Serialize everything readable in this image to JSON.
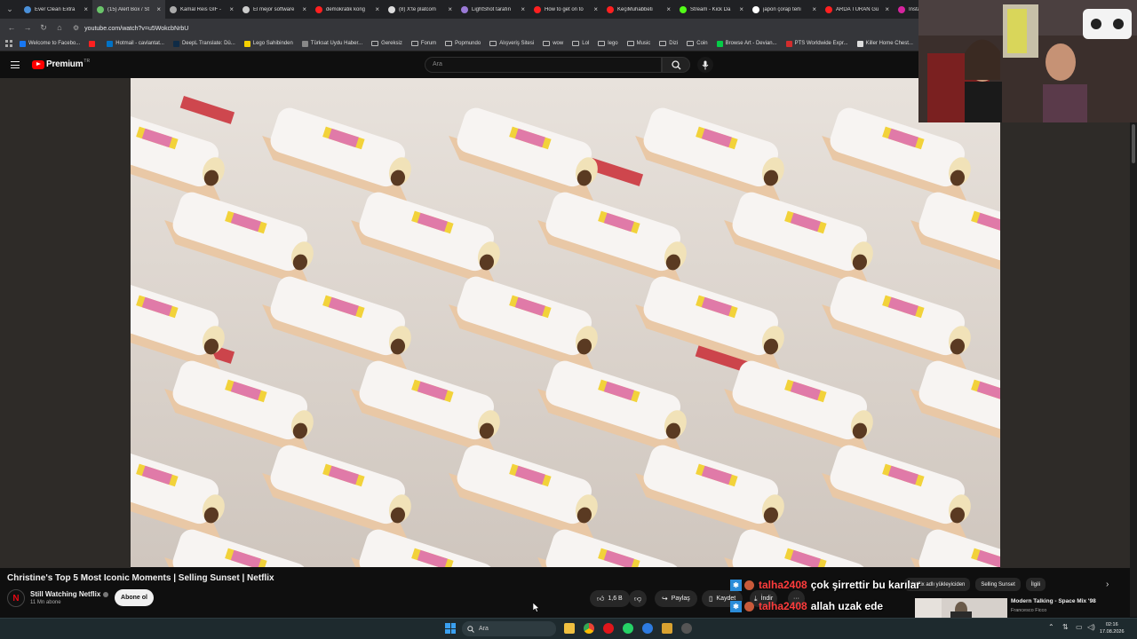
{
  "browser": {
    "tabs": [
      {
        "title": "Ever Clean Extra",
        "color": "#4a90d9"
      },
      {
        "title": "(15) Alert Box / St",
        "color": "#6ac46a"
      },
      {
        "title": "Kamal Reis GIF - ",
        "color": "#aaaaaa"
      },
      {
        "title": "El mejor software",
        "color": "#cccccc"
      },
      {
        "title": "demokratik kong",
        "color": "#ff2020"
      },
      {
        "title": "(8) X'te platcom",
        "color": "#dddddd"
      },
      {
        "title": "LightShot tarafın",
        "color": "#9a7ad6"
      },
      {
        "title": "How to get on to",
        "color": "#ff2020"
      },
      {
        "title": "KeçiMuhabbeti",
        "color": "#ff2020"
      },
      {
        "title": "Stream - Kick Da",
        "color": "#53fc18"
      },
      {
        "title": "japon çorap terli",
        "color": "#ffffff"
      },
      {
        "title": "ARDA TURAN Gü",
        "color": "#ff2020"
      },
      {
        "title": "Insta",
        "color": "#d6249f"
      }
    ],
    "url": "youtube.com/watch?v=u5WokcbNrbU",
    "bookmarks": [
      {
        "label": "Welcome to Facebo...",
        "type": "site",
        "color": "#1877f2"
      },
      {
        "label": "",
        "type": "site",
        "color": "#ff2020"
      },
      {
        "label": "Hotmail - cavlantat...",
        "type": "site",
        "color": "#0072c6"
      },
      {
        "label": "DeepL Translate: Dü...",
        "type": "site",
        "color": "#0f2b46"
      },
      {
        "label": "Lego Sahibinden",
        "type": "site",
        "color": "#f5d000"
      },
      {
        "label": "Türksat Uydu Haber...",
        "type": "site",
        "color": "#888888"
      },
      {
        "label": "Gereksiz",
        "type": "folder"
      },
      {
        "label": "Forum",
        "type": "folder"
      },
      {
        "label": "Popmundo",
        "type": "folder"
      },
      {
        "label": "Alışveriş Sitesi",
        "type": "folder"
      },
      {
        "label": "wow",
        "type": "folder"
      },
      {
        "label": "Lol",
        "type": "folder"
      },
      {
        "label": "lego",
        "type": "folder"
      },
      {
        "label": "Music",
        "type": "folder"
      },
      {
        "label": "Dizi",
        "type": "folder"
      },
      {
        "label": "Coin",
        "type": "folder"
      },
      {
        "label": "Browse Art - Devian...",
        "type": "site",
        "color": "#05cc47"
      },
      {
        "label": "PTS Worldwide Expr...",
        "type": "site",
        "color": "#d22d2d"
      },
      {
        "label": "Killer Home Chest...",
        "type": "site",
        "color": "#dddddd"
      }
    ]
  },
  "youtube": {
    "brand": "Premium",
    "region": "TR",
    "search_placeholder": "Ara",
    "video_title": "Christine's Top 5 Most Iconic Moments | Selling Sunset | Netflix",
    "channel": {
      "name": "Still Watching Netflix",
      "avatar_letter": "N",
      "subscribers": "11 Mn abone",
      "subscribe_label": "Abone ol"
    },
    "actions": {
      "likes": "1,6 B",
      "share": "Paylaş",
      "save": "Kaydet",
      "download": "İndir",
      "more": "···"
    },
    "chips": [
      "Netflix adlı yükleyiciden",
      "Selling Sunset",
      "İlgili"
    ],
    "recommendation": {
      "title": "Modern Talking - Space Mix '98",
      "author": "Francesco Ficco"
    }
  },
  "chat": [
    {
      "user": "talha2408",
      "message": "çok şirrettir bu karılar"
    },
    {
      "user": "talha2408",
      "message": "allah uzak ede"
    }
  ],
  "taskbar": {
    "search_label": "Ara",
    "time": "02:16",
    "date": "17.08.2026"
  },
  "colors": {
    "accent_red": "#ff0000",
    "chat_user": "#ff3c3c",
    "page_bg": "#0f0f0f"
  }
}
